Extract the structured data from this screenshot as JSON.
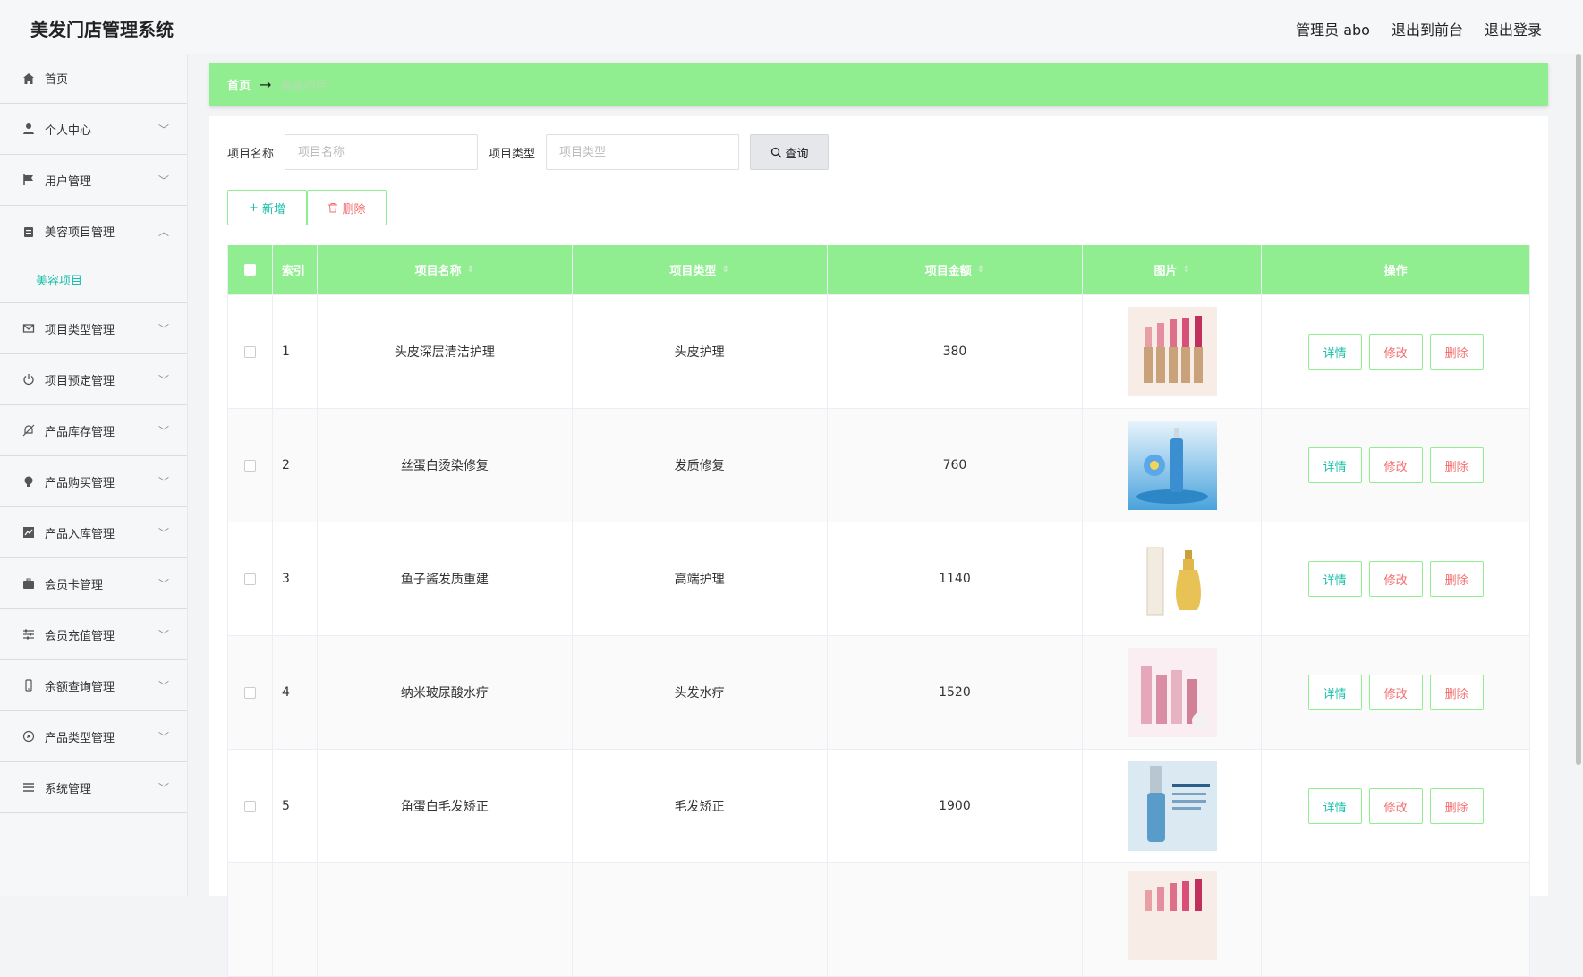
{
  "app": {
    "title": "美发门店管理系统",
    "user": "管理员 abo",
    "to_front": "退出到前台",
    "logout": "退出登录"
  },
  "sidebar": {
    "items": [
      {
        "label": "首页",
        "icon": "home-icon",
        "expandable": false
      },
      {
        "label": "个人中心",
        "icon": "user-icon",
        "expandable": true
      },
      {
        "label": "用户管理",
        "icon": "flag-icon",
        "expandable": true
      },
      {
        "label": "美容项目管理",
        "icon": "clipboard-icon",
        "expandable": true,
        "expanded": true
      },
      {
        "label": "项目类型管理",
        "icon": "mail-icon",
        "expandable": true
      },
      {
        "label": "项目预定管理",
        "icon": "power-icon",
        "expandable": true
      },
      {
        "label": "产品库存管理",
        "icon": "bell-off-icon",
        "expandable": true
      },
      {
        "label": "产品购买管理",
        "icon": "bulb-icon",
        "expandable": true
      },
      {
        "label": "产品入库管理",
        "icon": "chart-icon",
        "expandable": true
      },
      {
        "label": "会员卡管理",
        "icon": "suitcase-icon",
        "expandable": true
      },
      {
        "label": "会员充值管理",
        "icon": "sliders-icon",
        "expandable": true
      },
      {
        "label": "余额查询管理",
        "icon": "phone-icon",
        "expandable": true
      },
      {
        "label": "产品类型管理",
        "icon": "compass-icon",
        "expandable": true
      },
      {
        "label": "系统管理",
        "icon": "list-icon",
        "expandable": true
      }
    ],
    "submenu": "美容项目"
  },
  "breadcrumb": {
    "home": "首页",
    "arrow": "→",
    "current": "美容项目"
  },
  "search": {
    "name_label": "项目名称",
    "name_placeholder": "项目名称",
    "type_label": "项目类型",
    "type_placeholder": "项目类型",
    "query_button": "查询"
  },
  "actions": {
    "add": "新增",
    "delete": "删除"
  },
  "table": {
    "headers": {
      "index": "索引",
      "name": "项目名称",
      "type": "项目类型",
      "amount": "项目金额",
      "image": "图片",
      "op": "操作"
    },
    "rows": [
      {
        "index": "1",
        "name": "头皮深层清洁护理",
        "type": "头皮护理",
        "amount": "380",
        "image": "lipstick"
      },
      {
        "index": "2",
        "name": "丝蛋白烫染修复",
        "type": "发质修复",
        "amount": "760",
        "image": "serum"
      },
      {
        "index": "3",
        "name": "鱼子酱发质重建",
        "type": "高端护理",
        "amount": "1140",
        "image": "perfume"
      },
      {
        "index": "4",
        "name": "纳米玻尿酸水疗",
        "type": "头发水疗",
        "amount": "1520",
        "image": "pink-set"
      },
      {
        "index": "5",
        "name": "角蛋白毛发矫正",
        "type": "毛发矫正",
        "amount": "1900",
        "image": "essence"
      }
    ],
    "op_labels": {
      "detail": "详情",
      "edit": "修改",
      "delete": "删除"
    }
  },
  "colors": {
    "accent": "#90ee90",
    "teal": "#19bfa9",
    "danger": "#f56c6c"
  }
}
